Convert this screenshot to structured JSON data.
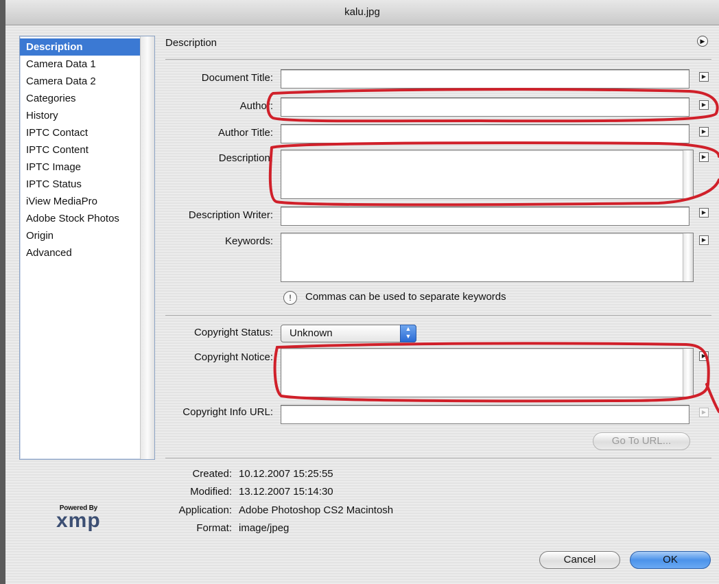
{
  "window": {
    "title": "kalu.jpg"
  },
  "sidebar": {
    "items": [
      {
        "label": "Description",
        "selected": true
      },
      {
        "label": "Camera Data 1"
      },
      {
        "label": "Camera Data 2"
      },
      {
        "label": "Categories"
      },
      {
        "label": "History"
      },
      {
        "label": "IPTC Contact"
      },
      {
        "label": "IPTC Content"
      },
      {
        "label": "IPTC Image"
      },
      {
        "label": "IPTC Status"
      },
      {
        "label": "iView MediaPro"
      },
      {
        "label": "Adobe Stock Photos"
      },
      {
        "label": "Origin"
      },
      {
        "label": "Advanced"
      }
    ]
  },
  "panel": {
    "title": "Description",
    "fields": {
      "document_title": {
        "label": "Document Title:",
        "value": ""
      },
      "author": {
        "label": "Author:",
        "value": ""
      },
      "author_title": {
        "label": "Author Title:",
        "value": ""
      },
      "description": {
        "label": "Description:",
        "value": ""
      },
      "description_writer": {
        "label": "Description Writer:",
        "value": ""
      },
      "keywords": {
        "label": "Keywords:",
        "value": ""
      },
      "copyright_status": {
        "label": "Copyright Status:",
        "value": "Unknown"
      },
      "copyright_notice": {
        "label": "Copyright Notice:",
        "value": ""
      },
      "copyright_info_url": {
        "label": "Copyright Info URL:",
        "value": ""
      }
    },
    "keywords_note": "Commas can be used to separate keywords",
    "go_to_url_label": "Go To URL..."
  },
  "file_info": {
    "created": {
      "label": "Created:",
      "value": "10.12.2007 15:25:55"
    },
    "modified": {
      "label": "Modified:",
      "value": "13.12.2007 15:14:30"
    },
    "application": {
      "label": "Application:",
      "value": "Adobe Photoshop CS2 Macintosh"
    },
    "format": {
      "label": "Format:",
      "value": "image/jpeg"
    }
  },
  "branding": {
    "powered_by": "Powered By",
    "logo": "xmp"
  },
  "buttons": {
    "cancel": "Cancel",
    "ok": "OK"
  },
  "icons": {
    "panel_menu": "circle-arrow-icon",
    "field_menu": "triangle-menu-icon",
    "note": "exclamation-icon",
    "select_arrows": "up-down-arrows-icon"
  },
  "colors": {
    "selection": "#3b79d3",
    "annotation": "#d0202a",
    "default_button": "#4c93ea"
  }
}
